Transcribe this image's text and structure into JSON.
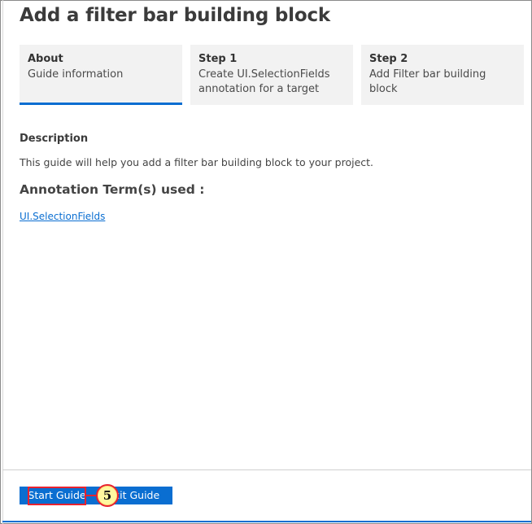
{
  "page": {
    "title": "Add a filter bar building block"
  },
  "steps": [
    {
      "title": "About",
      "description": "Guide information",
      "active": true
    },
    {
      "title": "Step 1",
      "description": "Create UI.SelectionFields annotation for a target",
      "active": false
    },
    {
      "title": "Step 2",
      "description": "Add Filter bar building block",
      "active": false
    }
  ],
  "content": {
    "description_label": "Description",
    "description_text": "This guide will help you add a filter bar building block to your project.",
    "annotation_title": "Annotation Term(s) used :",
    "annotation_link": "UI.SelectionFields"
  },
  "footer": {
    "start_label": "Start Guide",
    "exit_label": "Exit Guide"
  },
  "callout": {
    "number": "5"
  },
  "colors": {
    "accent": "#0a6ed1",
    "highlight": "#e8222f",
    "marker_fill": "#fff8a0"
  }
}
